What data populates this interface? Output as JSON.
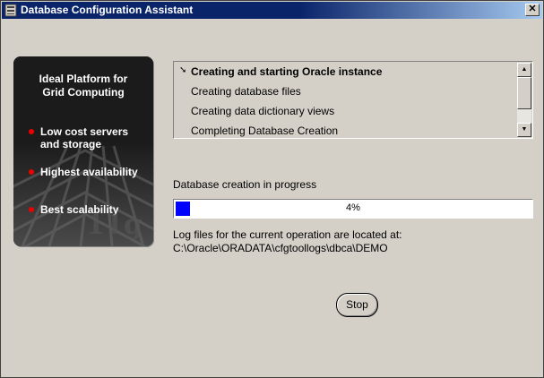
{
  "window": {
    "title": "Database Configuration Assistant",
    "close_label": "✕"
  },
  "promo": {
    "title_line1": "Ideal Platform for",
    "title_line2": "Grid Computing",
    "bullets": [
      {
        "line1": "Low cost servers",
        "line2": "and storage"
      },
      {
        "line1": "Highest availability",
        "line2": ""
      },
      {
        "line1": "Best scalability",
        "line2": ""
      }
    ],
    "logo_text": "11g"
  },
  "steps": {
    "items": [
      {
        "label": "Creating and starting Oracle instance",
        "state": "active"
      },
      {
        "label": "Creating database files",
        "state": "pending"
      },
      {
        "label": "Creating data dictionary views",
        "state": "pending"
      },
      {
        "label": "Completing Database Creation",
        "state": "pending"
      }
    ]
  },
  "status": {
    "label": "Database creation in progress",
    "progress_percent": 4,
    "progress_text": "4%"
  },
  "log": {
    "label": "Log files for the current operation are located at:",
    "path": "C:\\Oracle\\ORADATA\\cfgtoollogs\\dbca\\DEMO"
  },
  "actions": {
    "stop_label": "Stop"
  },
  "colors": {
    "titlebar": "#0a246a",
    "progress_fill": "#0000ff",
    "bullet_dot": "#e00000"
  }
}
